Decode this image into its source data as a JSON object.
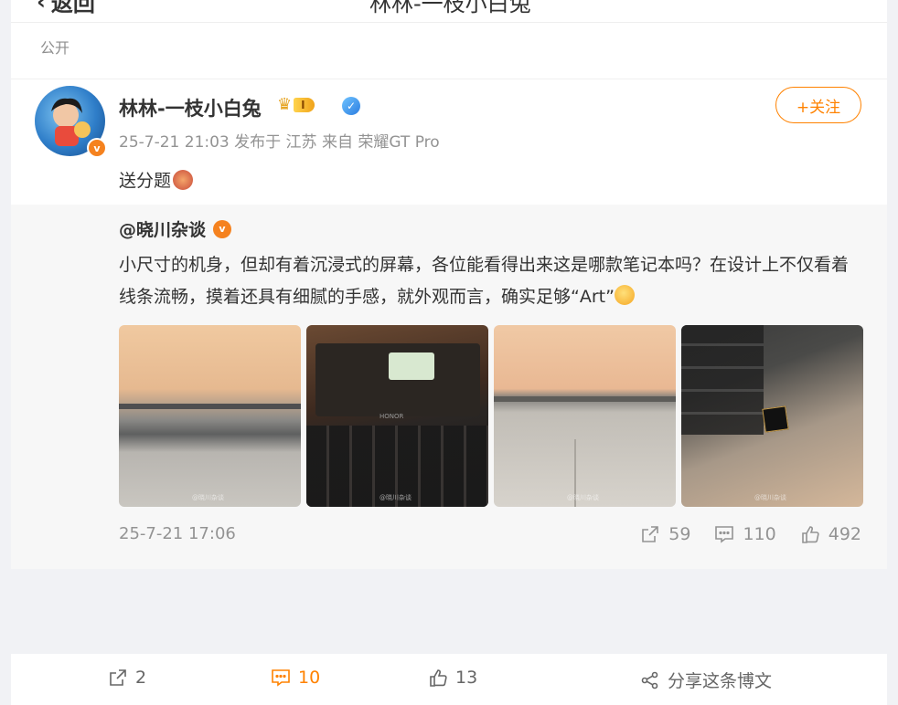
{
  "topbar": {
    "back_label": "返回",
    "title": "林林-一枝小白兔"
  },
  "post": {
    "visibility": "公开",
    "author": {
      "name": "林林-一枝小白兔",
      "level": "I",
      "avatar_icon": "avatar-image"
    },
    "follow_label": "+关注",
    "meta": "25-7-21 21:03 发布于 江苏 来自 荣耀GT Pro",
    "text": "送分题"
  },
  "quoted": {
    "author": "@晓川杂谈",
    "text": "小尺寸的机身，但却有着沉浸式的屏幕，各位能看得出来这是哪款笔记本吗？在设计上不仅看着线条流畅，摸着还具有细腻的手感，就外观而言，确实足够“Art”",
    "images": [
      {
        "watermark": "@晓川杂谈"
      },
      {
        "watermark": "@晓川杂谈",
        "brand": "HONOR"
      },
      {
        "watermark": "@晓川杂谈"
      },
      {
        "watermark": "@晓川杂谈"
      }
    ],
    "date": "25-7-21 17:06",
    "stats": {
      "reposts": "59",
      "comments": "110",
      "likes": "492"
    }
  },
  "bottom_bar": {
    "reposts": "2",
    "comments": "10",
    "likes": "13",
    "share_label": "分享这条博文"
  },
  "colors": {
    "accent": "#ff8200",
    "muted": "#939393",
    "background": "#f1f2f5"
  }
}
